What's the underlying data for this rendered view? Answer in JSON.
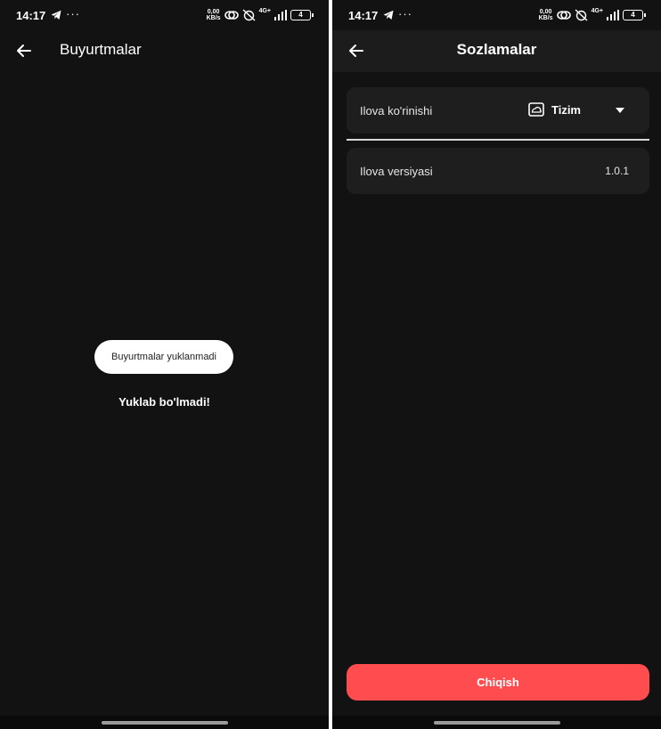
{
  "status_bar": {
    "time": "14:17",
    "more": "···",
    "speed_value": "0,00",
    "speed_unit": "KB/s",
    "network": "4G+",
    "battery": "4",
    "icons": [
      "telegram-icon",
      "link-icon",
      "alarm-off-icon",
      "signal-icon",
      "battery-icon"
    ]
  },
  "orders_screen": {
    "title": "Buyurtmalar",
    "toast": "Buyurtmalar yuklanmadi",
    "error": "Yuklab bo'lmadi!"
  },
  "settings_screen": {
    "title": "Sozlamalar",
    "appearance_label": "Ilova ko'rinishi",
    "appearance_value": "Tizim",
    "version_label": "Ilova versiyasi",
    "version_value": "1.0.1",
    "logout_label": "Chiqish"
  },
  "colors": {
    "background": "#121212",
    "card": "#1e1e1e",
    "appbar": "#1c1c1c",
    "logout": "#ff4d4f",
    "toast": "#ffffff"
  }
}
